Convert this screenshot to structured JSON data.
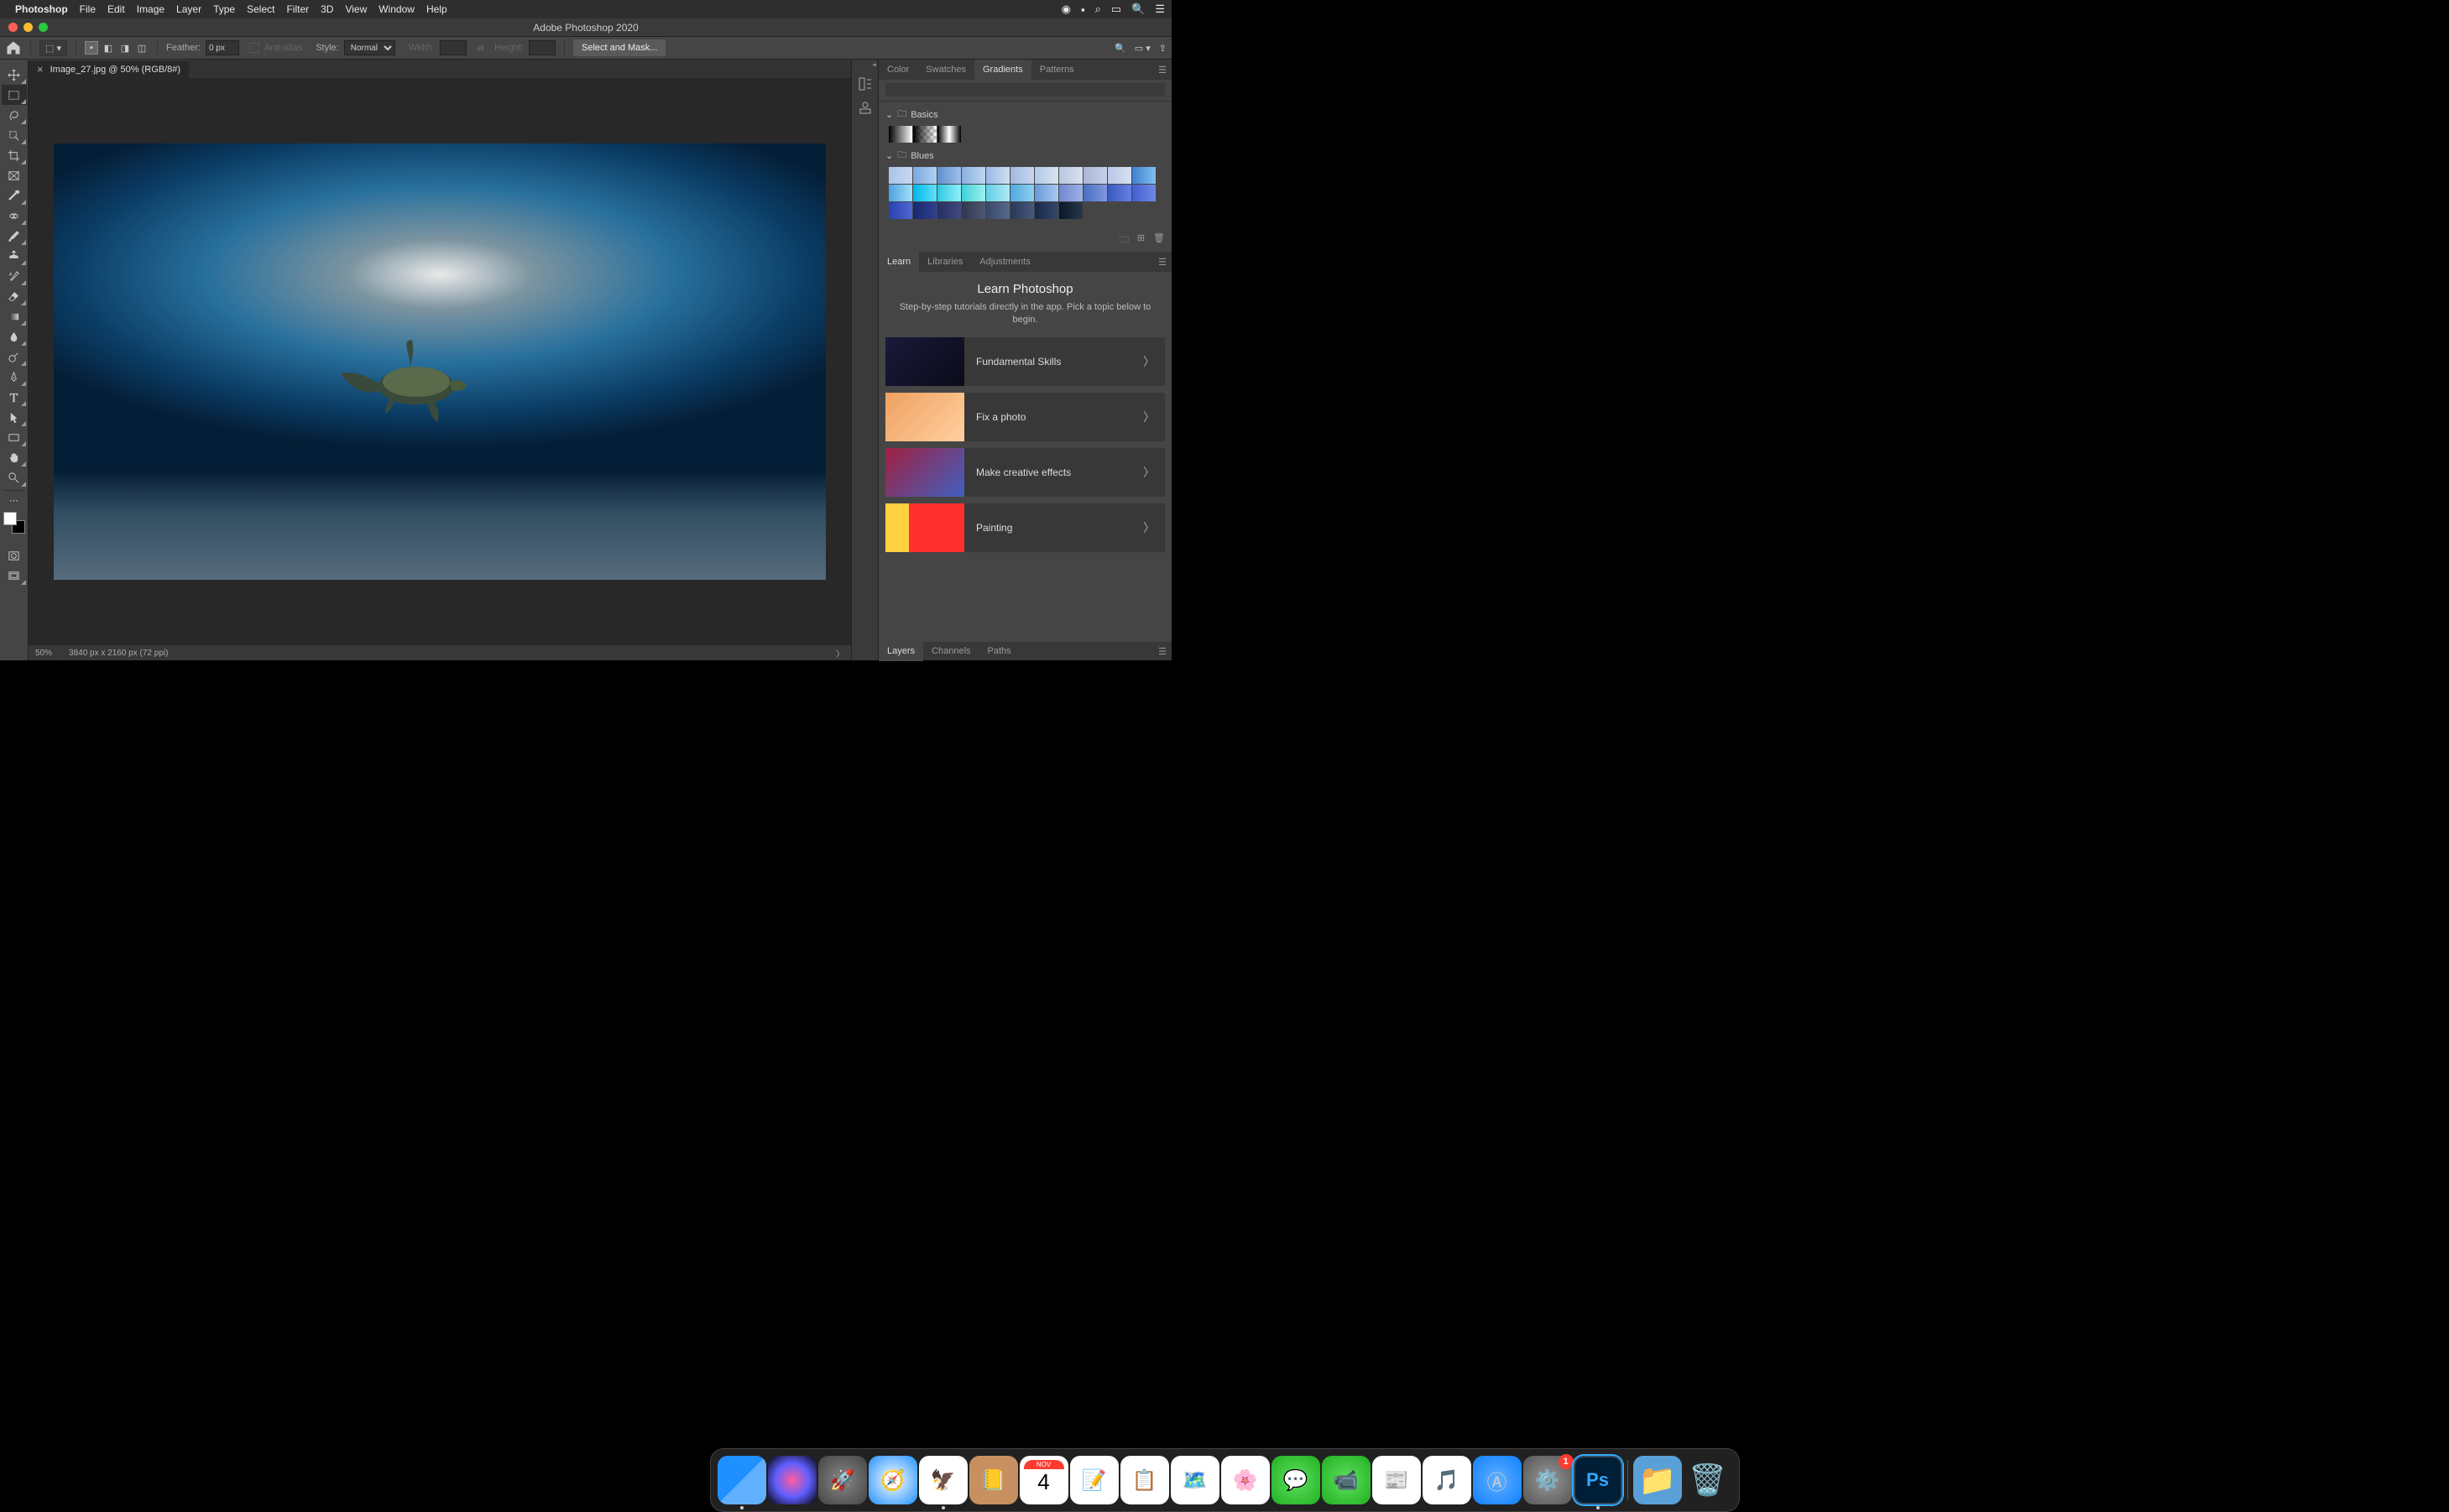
{
  "menubar": {
    "app": "Photoshop",
    "items": [
      "File",
      "Edit",
      "Image",
      "Layer",
      "Type",
      "Select",
      "Filter",
      "3D",
      "View",
      "Window",
      "Help"
    ]
  },
  "window": {
    "title": "Adobe Photoshop 2020"
  },
  "options": {
    "feather_label": "Feather:",
    "feather_value": "0 px",
    "antialias_label": "Anti-alias",
    "style_label": "Style:",
    "style_value": "Normal",
    "width_label": "Width:",
    "height_label": "Height:",
    "select_mask": "Select and Mask..."
  },
  "document": {
    "tab": "Image_27.jpg @ 50% (RGB/8#)",
    "zoom": "50%",
    "dimensions": "3840 px x 2160 px (72 ppi)"
  },
  "panels": {
    "top_tabs": [
      "Color",
      "Swatches",
      "Gradients",
      "Patterns"
    ],
    "gradients": {
      "groups": [
        {
          "name": "Basics",
          "colors": [
            [
              "#000",
              "#fff"
            ],
            [
              "#000",
              "transparent"
            ],
            [
              "#000",
              "#fff",
              "#000"
            ]
          ]
        },
        {
          "name": "Blues",
          "colors": [
            [
              "#a8c4e8",
              "#c8d8f0"
            ],
            [
              "#7aa8e0",
              "#b0d0f0"
            ],
            [
              "#6090d0",
              "#a0c0e8"
            ],
            [
              "#88b0e0",
              "#c0d8f0"
            ],
            [
              "#98b8e8",
              "#d0e0f0"
            ],
            [
              "#a0b8e0",
              "#c8d8f0"
            ],
            [
              "#b0c8e8",
              "#d8e4f0"
            ],
            [
              "#b8c8e0",
              "#d8e0f0"
            ],
            [
              "#a8b8d8",
              "#c8d0e8"
            ],
            [
              "#b8c8e8",
              "#d8e0f0"
            ],
            [
              "#4080d0",
              "#80c0f0"
            ],
            [
              "#50a0e0",
              "#a0e0f8"
            ],
            [
              "#00b8e8",
              "#60e0f8"
            ],
            [
              "#30c8e0",
              "#90f0f8"
            ],
            [
              "#40d0d8",
              "#a0f0f0"
            ],
            [
              "#60d0e8",
              "#b0e8f0"
            ],
            [
              "#50a8e0",
              "#90d0f0"
            ],
            [
              "#6898d8",
              "#a8c8f0"
            ],
            [
              "#7088d0",
              "#a0b0e8"
            ],
            [
              "#4870c0",
              "#8098e0"
            ],
            [
              "#3858c0",
              "#6880e0"
            ],
            [
              "#4060d0",
              "#7088e8"
            ],
            [
              "#2840b0",
              "#5068d0"
            ],
            [
              "#182870",
              "#304090"
            ],
            [
              "#283060",
              "#404880"
            ],
            [
              "#303850",
              "#505870"
            ],
            [
              "#384868",
              "#586888"
            ],
            [
              "#283858",
              "#485878"
            ],
            [
              "#182848",
              "#384868"
            ],
            [
              "#081828",
              "#283848"
            ]
          ]
        }
      ]
    },
    "mid_tabs": [
      "Learn",
      "Libraries",
      "Adjustments"
    ],
    "learn": {
      "title": "Learn Photoshop",
      "subtitle": "Step-by-step tutorials directly in the app. Pick a topic below to begin.",
      "items": [
        "Fundamental Skills",
        "Fix a photo",
        "Make creative effects",
        "Painting"
      ]
    },
    "bottom_tabs": [
      "Layers",
      "Channels",
      "Paths"
    ]
  },
  "tools": [
    {
      "name": "move-tool"
    },
    {
      "name": "rectangular-marquee-tool",
      "active": true
    },
    {
      "name": "lasso-tool"
    },
    {
      "name": "magic-wand-tool"
    },
    {
      "name": "crop-tool"
    },
    {
      "name": "frame-tool"
    },
    {
      "name": "eyedropper-tool"
    },
    {
      "name": "spot-healing-tool"
    },
    {
      "name": "brush-tool"
    },
    {
      "name": "clone-stamp-tool"
    },
    {
      "name": "history-brush-tool"
    },
    {
      "name": "eraser-tool"
    },
    {
      "name": "gradient-tool"
    },
    {
      "name": "blur-tool"
    },
    {
      "name": "dodge-tool"
    },
    {
      "name": "pen-tool"
    },
    {
      "name": "type-tool"
    },
    {
      "name": "path-selection-tool"
    },
    {
      "name": "rectangle-tool"
    },
    {
      "name": "hand-tool"
    },
    {
      "name": "zoom-tool"
    }
  ],
  "dock": {
    "apps": [
      {
        "name": "finder",
        "bg": "linear-gradient(135deg,#1e90ff 50%,#60b0ff 50%)",
        "glyph": "",
        "running": true
      },
      {
        "name": "siri",
        "bg": "radial-gradient(circle,#ff5e9e,#5e5eff,#000)",
        "glyph": ""
      },
      {
        "name": "launchpad",
        "bg": "radial-gradient(circle,#888,#444)",
        "glyph": "🚀"
      },
      {
        "name": "safari",
        "bg": "radial-gradient(circle,#fff,#2090ff)",
        "glyph": "🧭"
      },
      {
        "name": "mail",
        "bg": "#fff",
        "glyph": "🦅",
        "running": true
      },
      {
        "name": "contacts",
        "bg": "#c89060",
        "glyph": "📒"
      },
      {
        "name": "calendar",
        "bg": "#fff",
        "glyph": "📅",
        "text": "4"
      },
      {
        "name": "notes",
        "bg": "#fff",
        "glyph": "📝"
      },
      {
        "name": "reminders",
        "bg": "#fff",
        "glyph": "📋"
      },
      {
        "name": "maps",
        "bg": "#fff",
        "glyph": "🗺️"
      },
      {
        "name": "photos",
        "bg": "#fff",
        "glyph": "🌸"
      },
      {
        "name": "messages",
        "bg": "radial-gradient(circle,#60e060,#20b020)",
        "glyph": "💬"
      },
      {
        "name": "facetime",
        "bg": "radial-gradient(circle,#60e060,#20b020)",
        "glyph": "📹"
      },
      {
        "name": "news",
        "bg": "#fff",
        "glyph": "📰"
      },
      {
        "name": "music",
        "bg": "#fff",
        "glyph": "🎵"
      },
      {
        "name": "appstore",
        "bg": "radial-gradient(circle,#60b0ff,#1080ff)",
        "glyph": "Ⓐ"
      },
      {
        "name": "settings",
        "bg": "radial-gradient(circle,#999,#555)",
        "glyph": "⚙️",
        "badge": "1"
      },
      {
        "name": "photoshop",
        "bg": "#001e36",
        "glyph": "Ps",
        "running": true,
        "active": true
      }
    ],
    "right": [
      {
        "name": "downloads",
        "bg": "#5aa0d8",
        "glyph": "📁"
      },
      {
        "name": "trash",
        "bg": "transparent",
        "glyph": "🗑️"
      }
    ]
  }
}
